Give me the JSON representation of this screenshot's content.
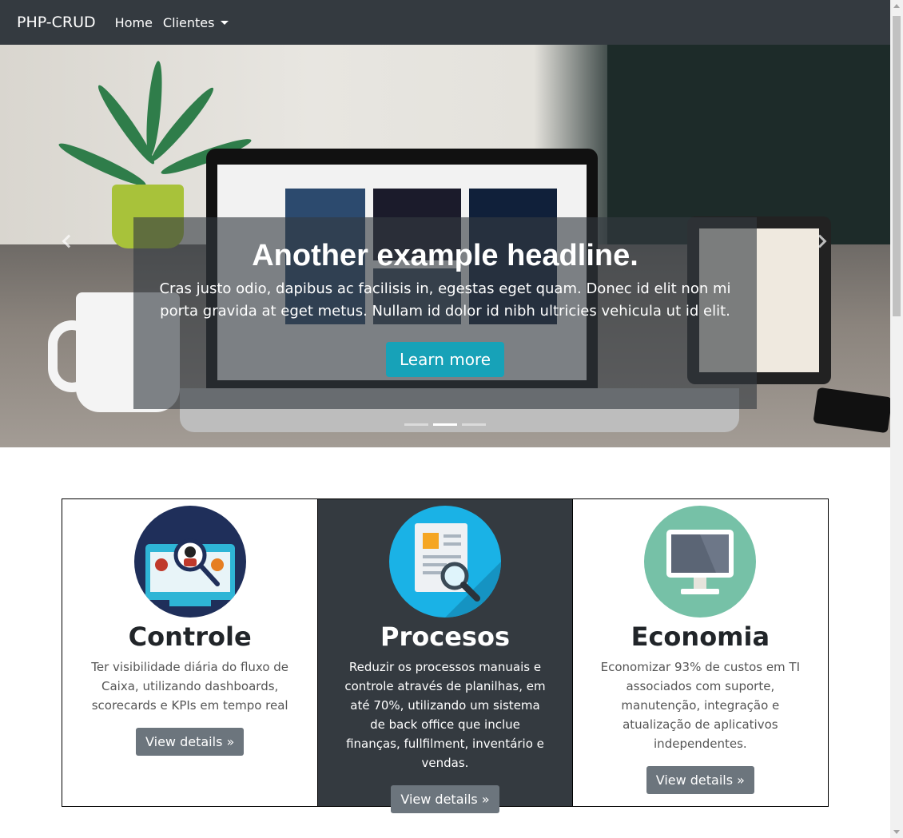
{
  "navbar": {
    "brand": "PHP-CRUD",
    "links": [
      {
        "label": "Home"
      },
      {
        "label": "Clientes"
      }
    ]
  },
  "carousel": {
    "headline": "Another example headline.",
    "text": "Cras justo odio, dapibus ac facilisis in, egestas eget quam. Donec id elit non mi porta gravida at eget metus. Nullam id dolor id nibh ultricies vehicula ut id elit.",
    "button_label": "Learn more",
    "indicators_count": 3,
    "active_indicator": 2
  },
  "features": [
    {
      "title": "Controle",
      "text": "Ter visibilidade diária do fluxo de Caixa, utilizando dashboards, scorecards e KPIs em tempo real",
      "button_label": "View details »",
      "icon": "people-search-icon"
    },
    {
      "title": "Procesos",
      "text": "Reduzir os processos manuais e controle através de planilhas, em até 70%, utilizando um sistema de back office que inclue finanças, fullfilment, inventário e vendas.",
      "button_label": "View details »",
      "icon": "document-search-icon"
    },
    {
      "title": "Economia",
      "text": "Economizar 93% de custos em TI associados com suporte, manutenção, integração e atualização de aplicativos independentes.",
      "button_label": "View details »",
      "icon": "monitor-icon"
    }
  ],
  "colors": {
    "navbar": "#343a40",
    "info": "#17a2b8",
    "secondary": "#6c757d"
  }
}
